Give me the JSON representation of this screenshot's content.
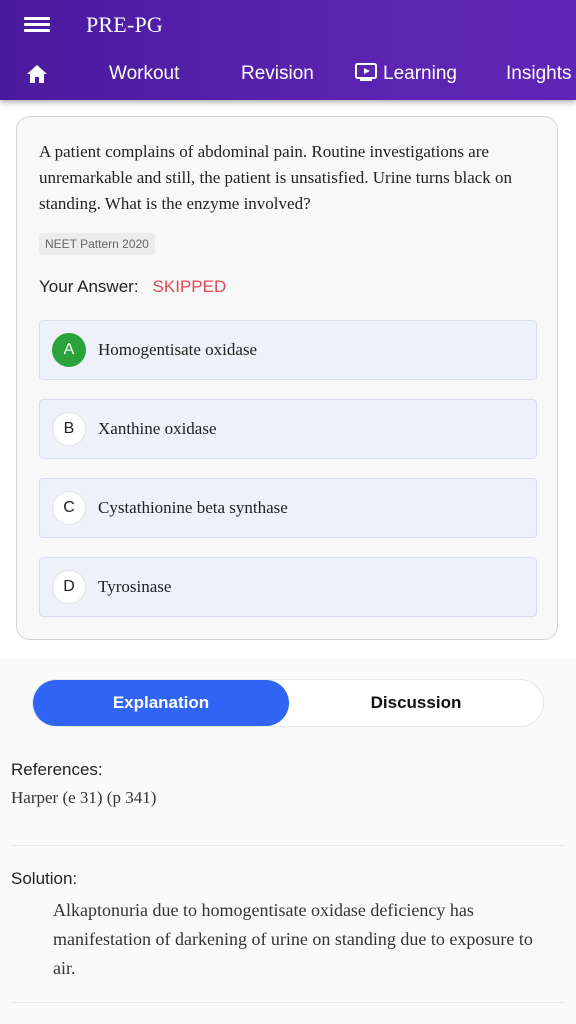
{
  "app": {
    "title": "PRE-PG"
  },
  "nav": {
    "items": [
      {
        "label": "Workout"
      },
      {
        "label": "Revision"
      },
      {
        "label": "Learning"
      },
      {
        "label": "Insights"
      }
    ]
  },
  "question": {
    "text": "A patient complains of abdominal pain. Routine investigations are unremarkable and still, the patient is unsatisfied. Urine turns black on standing. What is the enzyme involved?",
    "pattern": "NEET Pattern 2020",
    "answer_label": "Your Answer:",
    "answer_status": "SKIPPED",
    "options": [
      {
        "letter": "A",
        "text": "Homogentisate oxidase",
        "correct": true
      },
      {
        "letter": "B",
        "text": "Xanthine oxidase",
        "correct": false
      },
      {
        "letter": "C",
        "text": "Cystathionine beta synthase",
        "correct": false
      },
      {
        "letter": "D",
        "text": "Tyrosinase",
        "correct": false
      }
    ]
  },
  "tabs": {
    "explanation": "Explanation",
    "discussion": "Discussion"
  },
  "references": {
    "label": "References:",
    "text": "Harper (e 31) (p 341)"
  },
  "solution": {
    "label": "Solution:",
    "text": "Alkaptonuria due to homogentisate oxidase deficiency has manifestation of darkening of urine on standing due to exposure to air."
  },
  "colors": {
    "header": "#5a23b0",
    "correct": "#2aa43a",
    "skipped": "#e04a55",
    "active_tab": "#2f64f4"
  }
}
